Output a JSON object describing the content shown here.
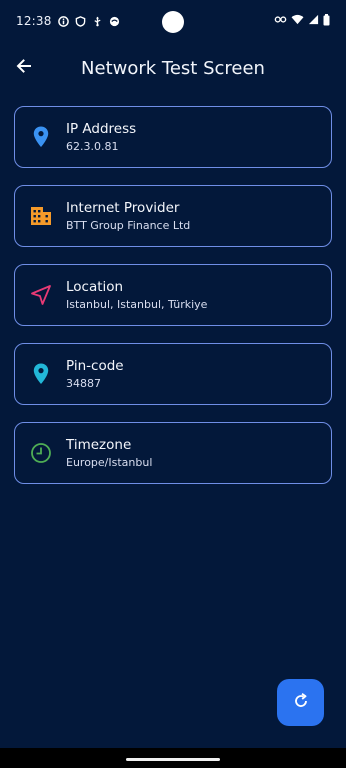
{
  "status_bar": {
    "time": "12:38",
    "left_icons": [
      "info-icon",
      "shield-icon",
      "usb-icon",
      "app-icon"
    ],
    "right_icons": [
      "key-icon",
      "wifi-icon",
      "signal-icon",
      "battery-icon"
    ]
  },
  "appbar": {
    "title": "Network Test Screen",
    "back_icon": "arrow-left-icon"
  },
  "cards": [
    {
      "title": "IP Address",
      "value": "62.3.0.81",
      "icon": "location-pin-icon",
      "icon_color": "#3a92f2"
    },
    {
      "title": "Internet Provider",
      "value": "BTT Group Finance Ltd",
      "icon": "building-icon",
      "icon_color": "#f59a2a"
    },
    {
      "title": "Location",
      "value": "Istanbul, Istanbul, Türkiye",
      "icon": "navigation-arrow-icon",
      "icon_color": "#e83a75"
    },
    {
      "title": "Pin-code",
      "value": "34887",
      "icon": "location-pin-icon",
      "icon_color": "#22b7d8"
    },
    {
      "title": "Timezone",
      "value": "Europe/Istanbul",
      "icon": "clock-icon",
      "icon_color": "#4fae55"
    }
  ],
  "fab": {
    "icon": "refresh-icon",
    "color": "#2b73f0"
  },
  "colors": {
    "background": "#03183a",
    "card_border": "#6f8ee6"
  }
}
